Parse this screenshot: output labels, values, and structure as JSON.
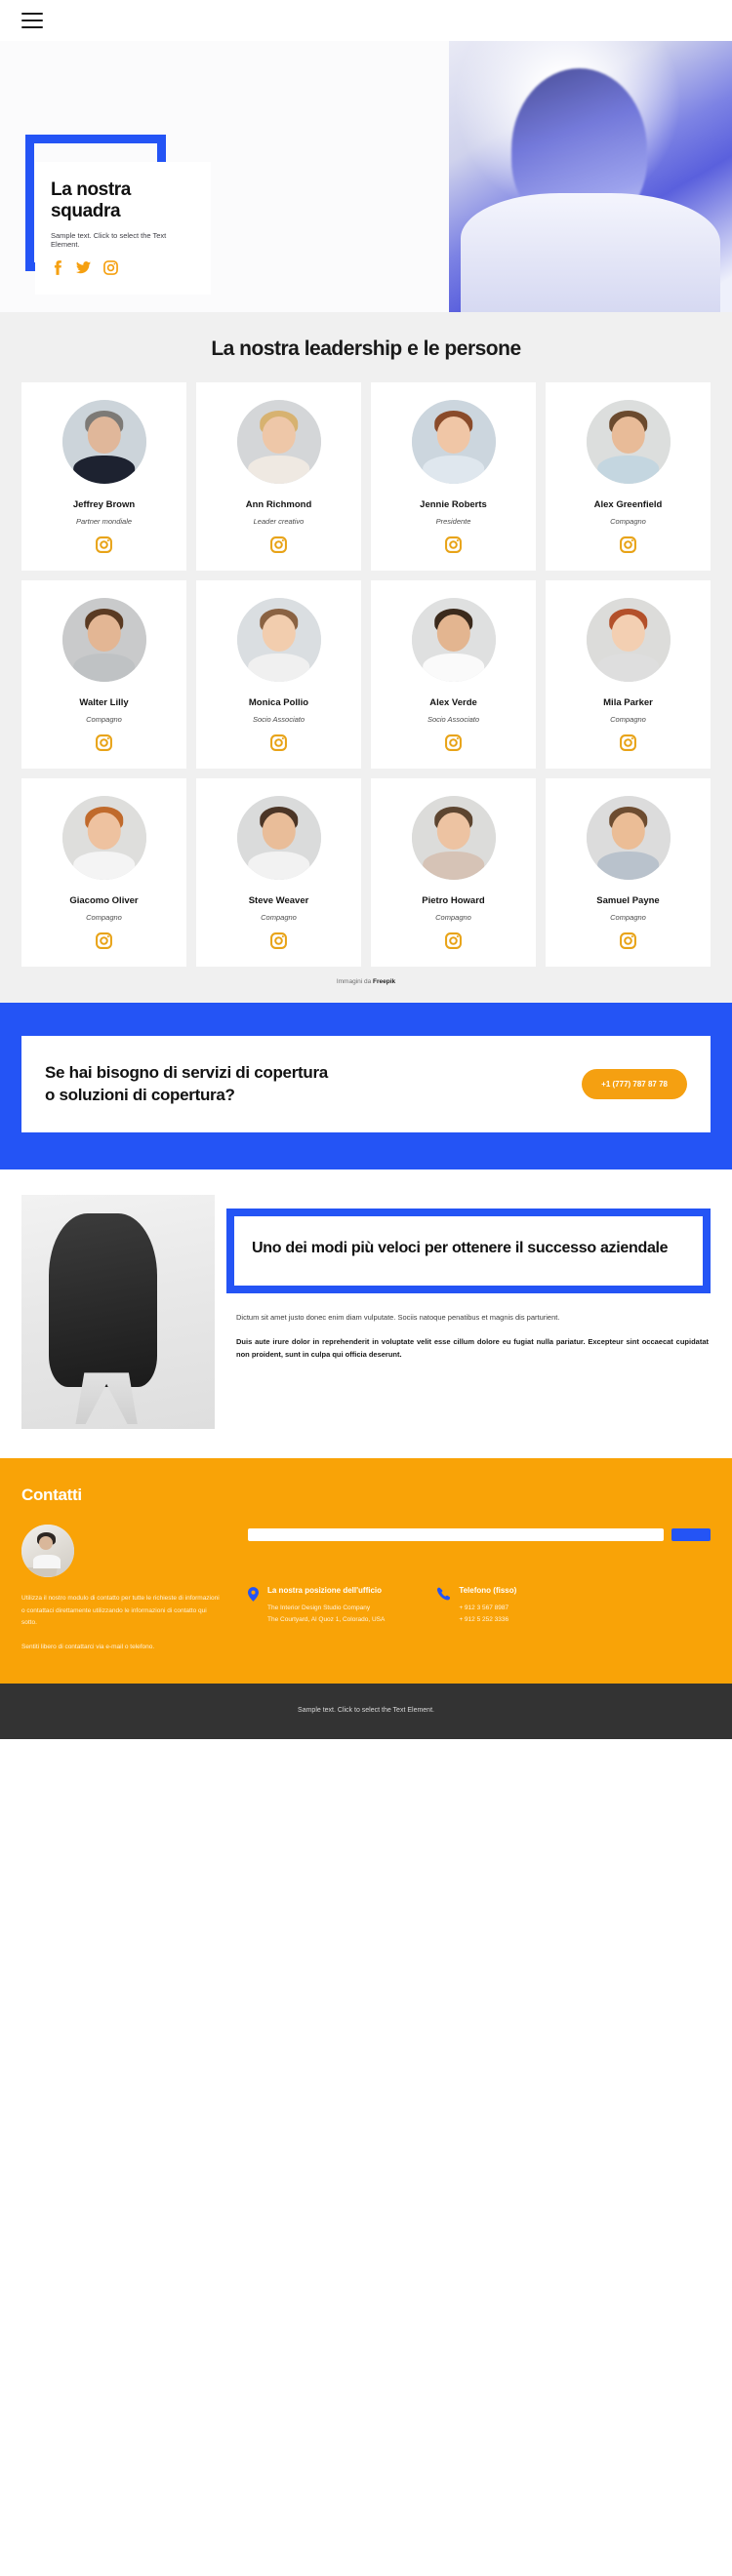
{
  "topbar": {
    "menu_icon": "hamburger-menu-icon"
  },
  "hero": {
    "title": "La nostra squadra",
    "subtitle": "Sample text. Click to select the Text Element.",
    "socials": [
      {
        "name": "facebook-icon",
        "label": "Facebook"
      },
      {
        "name": "twitter-icon",
        "label": "Twitter"
      },
      {
        "name": "instagram-icon",
        "label": "Instagram"
      }
    ]
  },
  "team": {
    "title": "La nostra leadership e le persone",
    "credits_prefix": "Immagini da ",
    "credits_link": "Freepik",
    "members": [
      {
        "name": "Jeffrey Brown",
        "role": "Partner mondiale",
        "social": "instagram-icon",
        "bg": "#ccd4da",
        "skin": "#e0b79a",
        "hair": "#7d7a76",
        "body": "#1d2230"
      },
      {
        "name": "Ann Richmond",
        "role": "Leader creativo",
        "social": "instagram-icon",
        "bg": "#d4d6d8",
        "skin": "#eec7a8",
        "hair": "#d7b270",
        "body": "#efe9e2"
      },
      {
        "name": "Jennie Roberts",
        "role": "Presidente",
        "social": "instagram-icon",
        "bg": "#ccd6de",
        "skin": "#f0c6a6",
        "hair": "#8a4b2a",
        "body": "#dfe7ee"
      },
      {
        "name": "Alex Greenfield",
        "role": "Compagno",
        "social": "instagram-icon",
        "bg": "#dcdedd",
        "skin": "#e8bb98",
        "hair": "#6b4a2e",
        "body": "#c4d6e0"
      },
      {
        "name": "Walter Lilly",
        "role": "Compagno",
        "social": "instagram-icon",
        "bg": "#c9cacb",
        "skin": "#e3b694",
        "hair": "#5a3a22",
        "body": "#bfc2c4"
      },
      {
        "name": "Monica Pollio",
        "role": "Socio Associato",
        "social": "instagram-icon",
        "bg": "#dadee1",
        "skin": "#f2cdae",
        "hair": "#8a6242",
        "body": "#f0f0f0"
      },
      {
        "name": "Alex Verde",
        "role": "Socio Associato",
        "social": "instagram-icon",
        "bg": "#dfe0e0",
        "skin": "#e3b590",
        "hair": "#3b2a1c",
        "body": "#fafafa"
      },
      {
        "name": "Mila Parker",
        "role": "Compagno",
        "social": "instagram-icon",
        "bg": "#dcdcda",
        "skin": "#f3cfb2",
        "hair": "#b3502a",
        "body": "#dedede"
      },
      {
        "name": "Giacomo Oliver",
        "role": "Compagno",
        "social": "instagram-icon",
        "bg": "#dededc",
        "skin": "#eec2a0",
        "hair": "#c06a2c",
        "body": "#f4f4f4"
      },
      {
        "name": "Steve Weaver",
        "role": "Compagno",
        "social": "instagram-icon",
        "bg": "#dadbdb",
        "skin": "#e9bd99",
        "hair": "#4b3526",
        "body": "#f2f2f2"
      },
      {
        "name": "Pietro Howard",
        "role": "Compagno",
        "social": "instagram-icon",
        "bg": "#dcdcda",
        "skin": "#edc3a2",
        "hair": "#5d4530",
        "body": "#d6c3b6"
      },
      {
        "name": "Samuel Payne",
        "role": "Compagno",
        "social": "instagram-icon",
        "bg": "#dcdcdc",
        "skin": "#ebbd96",
        "hair": "#6d4c30",
        "body": "#b9c2cc"
      }
    ]
  },
  "cta": {
    "heading": "Se hai bisogno di servizi di copertura o soluzioni di copertura?",
    "phone_label": "+1 (777) 787 87 78"
  },
  "success": {
    "title": "Uno dei modi più veloci per ottenere il successo aziendale",
    "paragraph": "Dictum sit amet justo donec enim diam vulputate. Sociis natoque penatibus et magnis dis parturient.",
    "paragraph_bold": "Duis aute irure dolor in reprehenderit in voluptate velit esse cillum dolore eu fugiat nulla pariatur. Excepteur sint occaecat cupidatat non proident, sunt in culpa qui officia deserunt."
  },
  "contacts": {
    "title": "Contatti",
    "text_1": "Utilizza il nostro modulo di contatto per tutte le richieste di informazioni o contattaci direttamente utilizzando le informazioni di contatto qui sotto.",
    "text_2": "Sentiti libero di contattarci via e-mail o telefono.",
    "form": {
      "input_placeholder": "",
      "input_value": "",
      "submit_label": ""
    },
    "location": {
      "icon": "map-pin-icon",
      "heading": "La nostra posizione dell'ufficio",
      "line_1": "The Interior Design Studio Company",
      "line_2": "The Courtyard, Al Quoz 1, Colorado,  USA"
    },
    "phone": {
      "icon": "phone-icon",
      "heading": "Telefono (fisso)",
      "line_1": "+ 912 3 567 8987",
      "line_2": "+ 912 5 252 3336"
    }
  },
  "footer": {
    "text": "Sample text. Click to select the Text Element."
  },
  "colors": {
    "blue": "#2454f5",
    "orange": "#f9a307",
    "amber": "#e8a317",
    "dark": "#333333"
  }
}
